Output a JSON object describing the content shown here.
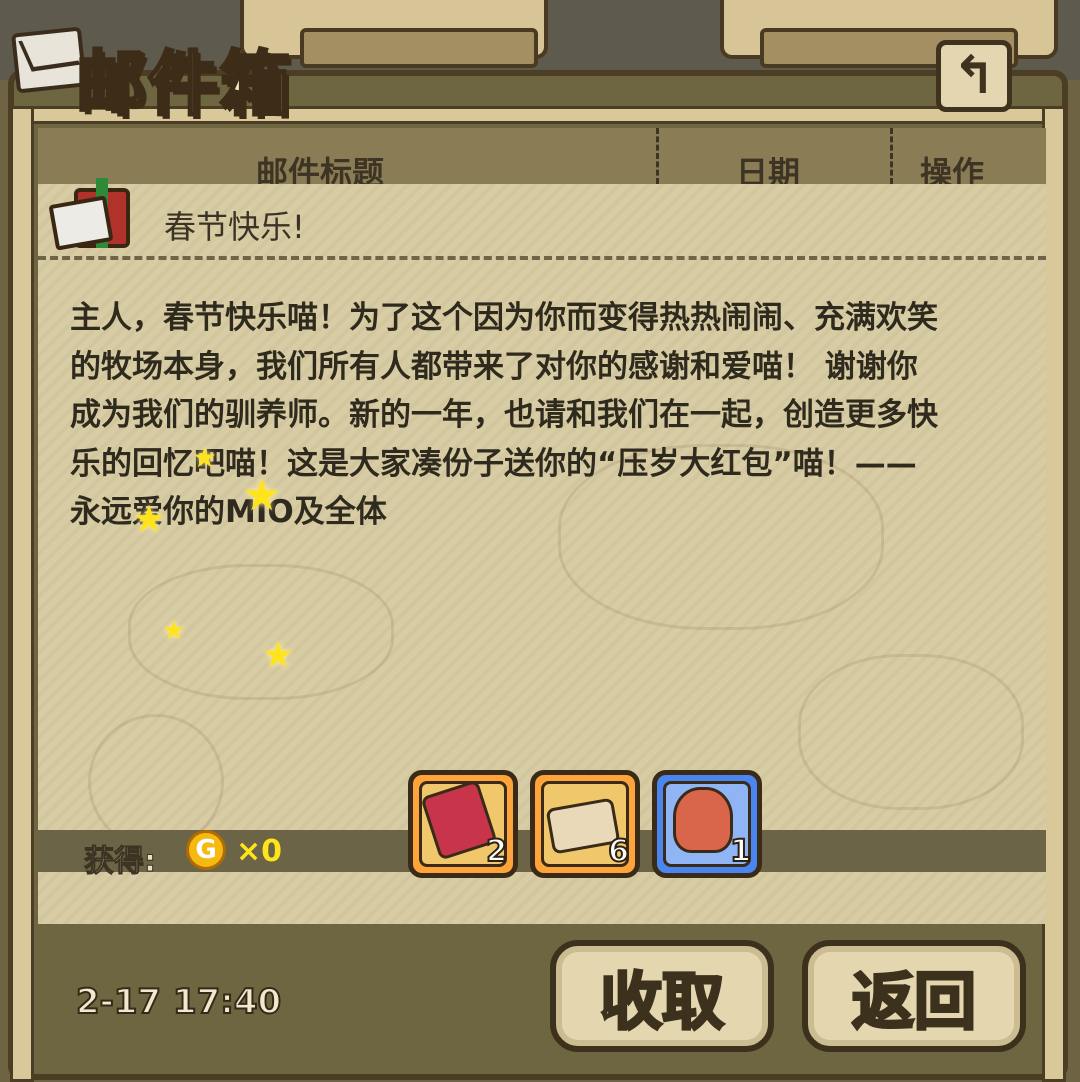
{
  "window": {
    "title": "邮件箱"
  },
  "header": {
    "col_subject": "邮件标题",
    "col_date": "日期",
    "col_action": "操作"
  },
  "mail": {
    "subject": "春节快乐!",
    "body": "主人，春节快乐喵！为了这个因为你而变得热热闹闹、充满欢笑\n的牧场本身，我们所有人都带来了对你的感谢和爱喵！ 谢谢你\n成为我们的驯养师。新的一年，也请和我们在一起，创造更多快\n乐的回忆吧喵！这是大家凑份子送你的“压岁大红包”喵！——\n永远爱你的MIO及全体",
    "date": "2-17 17:40"
  },
  "rewards": {
    "label": "获得:",
    "coin_symbol": "G",
    "coin_count": "×0",
    "items": [
      {
        "name": "red-envelope",
        "count": "2",
        "frame": "orange"
      },
      {
        "name": "ticket",
        "count": "6",
        "frame": "orange"
      },
      {
        "name": "seed",
        "count": "1",
        "frame": "blue"
      }
    ]
  },
  "buttons": {
    "claim": "收取",
    "back": "返回",
    "back_icon": "↰"
  },
  "colors": {
    "parchment": "#d8cca4",
    "frame": "#4b3e24",
    "coin": "#f5b90f",
    "slot_orange": "#ffa43a",
    "slot_blue": "#4b86f0"
  }
}
